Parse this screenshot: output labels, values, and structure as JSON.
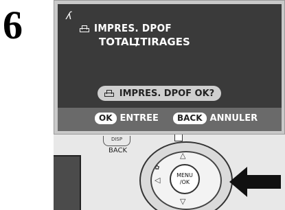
{
  "step": "6",
  "lcd": {
    "hand_icon": "ʎ",
    "title": "IMPRES. DPOF",
    "total_prefix": "TOTAL/",
    "total_value": "1TIRAGES",
    "confirm_label": "IMPRES. DPOF OK?",
    "softkeys": {
      "ok_badge": "OK",
      "ok_label": "ENTREE",
      "back_badge": "BACK",
      "back_label": "ANNULER"
    }
  },
  "camera": {
    "disp_label": "DISP",
    "back_label": "BACK",
    "menu_line1": "MENU",
    "menu_line2": "/OK",
    "up_arrow": "△",
    "down_arrow": "▽",
    "left_arrow": "◁",
    "macro_icon": "✿"
  },
  "colors": {
    "lcd_bg": "#3a3a3a",
    "softkey_bar": "#6a6a6a",
    "frame": "#c9c9c9"
  }
}
